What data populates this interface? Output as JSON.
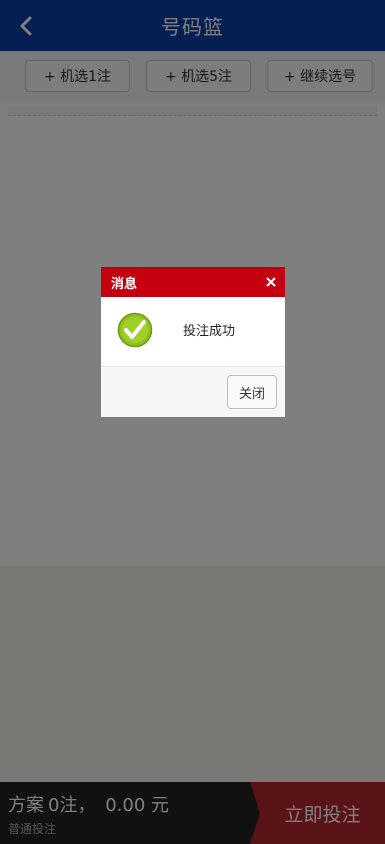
{
  "header": {
    "title": "号码篮",
    "back_icon": "chevron-left-icon"
  },
  "toolbar": {
    "random1_label": "+ 机选1注",
    "random5_label": "+ 机选5注",
    "continue_label": "+ 继续选号"
  },
  "footer": {
    "plan_label": "方案",
    "bet_count": "0注，",
    "amount": "0.00 元",
    "mode": "普通投注",
    "submit_label": "立即投注"
  },
  "dialog": {
    "title": "消息",
    "message": "投注成功",
    "close_label": "关闭",
    "icon": "check-circle-icon"
  },
  "colors": {
    "header_bg": "#0d3fa6",
    "dialog_header": "#c40010",
    "submit_bg": "#b3272d",
    "success_icon": "#8dc21f"
  }
}
